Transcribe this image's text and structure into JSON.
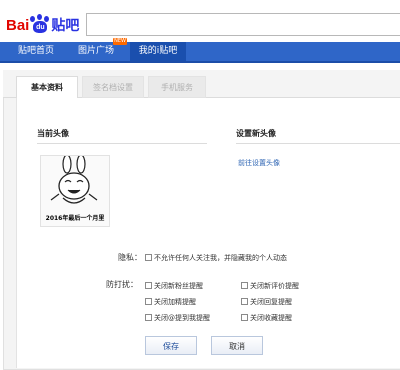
{
  "header": {
    "logo": {
      "bai": "Bai",
      "du": "du",
      "tieba": "贴吧"
    }
  },
  "nav": {
    "items": [
      {
        "label": "贴吧首页"
      },
      {
        "label": "图片广场",
        "badge": "NEW"
      },
      {
        "label": "我的i贴吧"
      }
    ]
  },
  "tabs": [
    {
      "label": "基本资料",
      "active": true
    },
    {
      "label": "签名档设置",
      "active": false
    },
    {
      "label": "手机服务",
      "active": false
    }
  ],
  "avatar": {
    "current_title": "当前头像",
    "caption": "2016年最后一个月里",
    "set_title": "设置新头像",
    "set_link": "前往设置头像"
  },
  "privacy": {
    "label": "隐私：",
    "option": "不允许任何人关注我，并隐藏我的个人动态"
  },
  "disturb": {
    "label": "防打扰：",
    "options": [
      "关闭新粉丝提醒",
      "关闭新评价提醒",
      "关闭加精提醒",
      "关闭回复提醒",
      "关闭@提到我提醒",
      "关闭收藏提醒"
    ]
  },
  "buttons": {
    "save": "保存",
    "cancel": "取消"
  },
  "colors": {
    "nav": "#2f66c8",
    "nav_active": "#1a4fae",
    "link": "#2d64b3",
    "baidu_red": "#e10601",
    "baidu_blue": "#2932e1"
  }
}
